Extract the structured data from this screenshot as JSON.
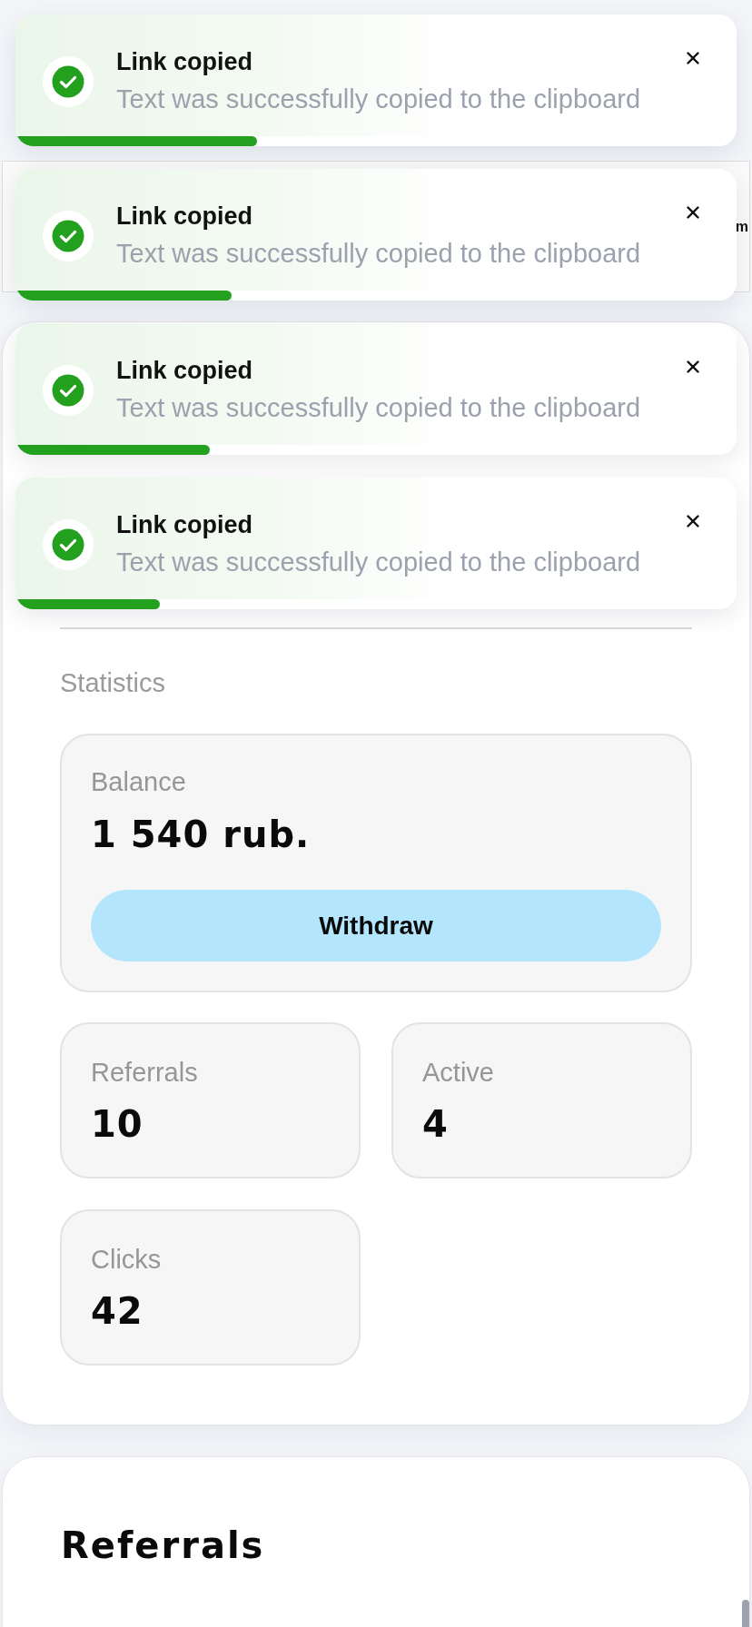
{
  "toasts": [
    {
      "title": "Link copied",
      "message": "Text was successfully copied to the clipboard",
      "level": 0.335
    },
    {
      "title": "Link copied",
      "message": "Text was successfully copied to the clipboard",
      "level": 0.3
    },
    {
      "title": "Link copied",
      "message": "Text was successfully copied to the clipboard",
      "level": 0.27
    },
    {
      "title": "Link copied",
      "message": "Text was successfully copied to the clipboard",
      "level": 0.2
    }
  ],
  "top_bar": {
    "text": "m"
  },
  "statistics": {
    "title": "Statistics",
    "balance": {
      "label": "Balance",
      "amount": "1 540 rub.",
      "button": "Withdraw"
    },
    "tiles": [
      {
        "label": "Referrals",
        "value": "10"
      },
      {
        "label": "Active",
        "value": "4"
      },
      {
        "label": "Clicks",
        "value": "42"
      }
    ]
  },
  "referrals": {
    "title": "Referrals"
  }
}
